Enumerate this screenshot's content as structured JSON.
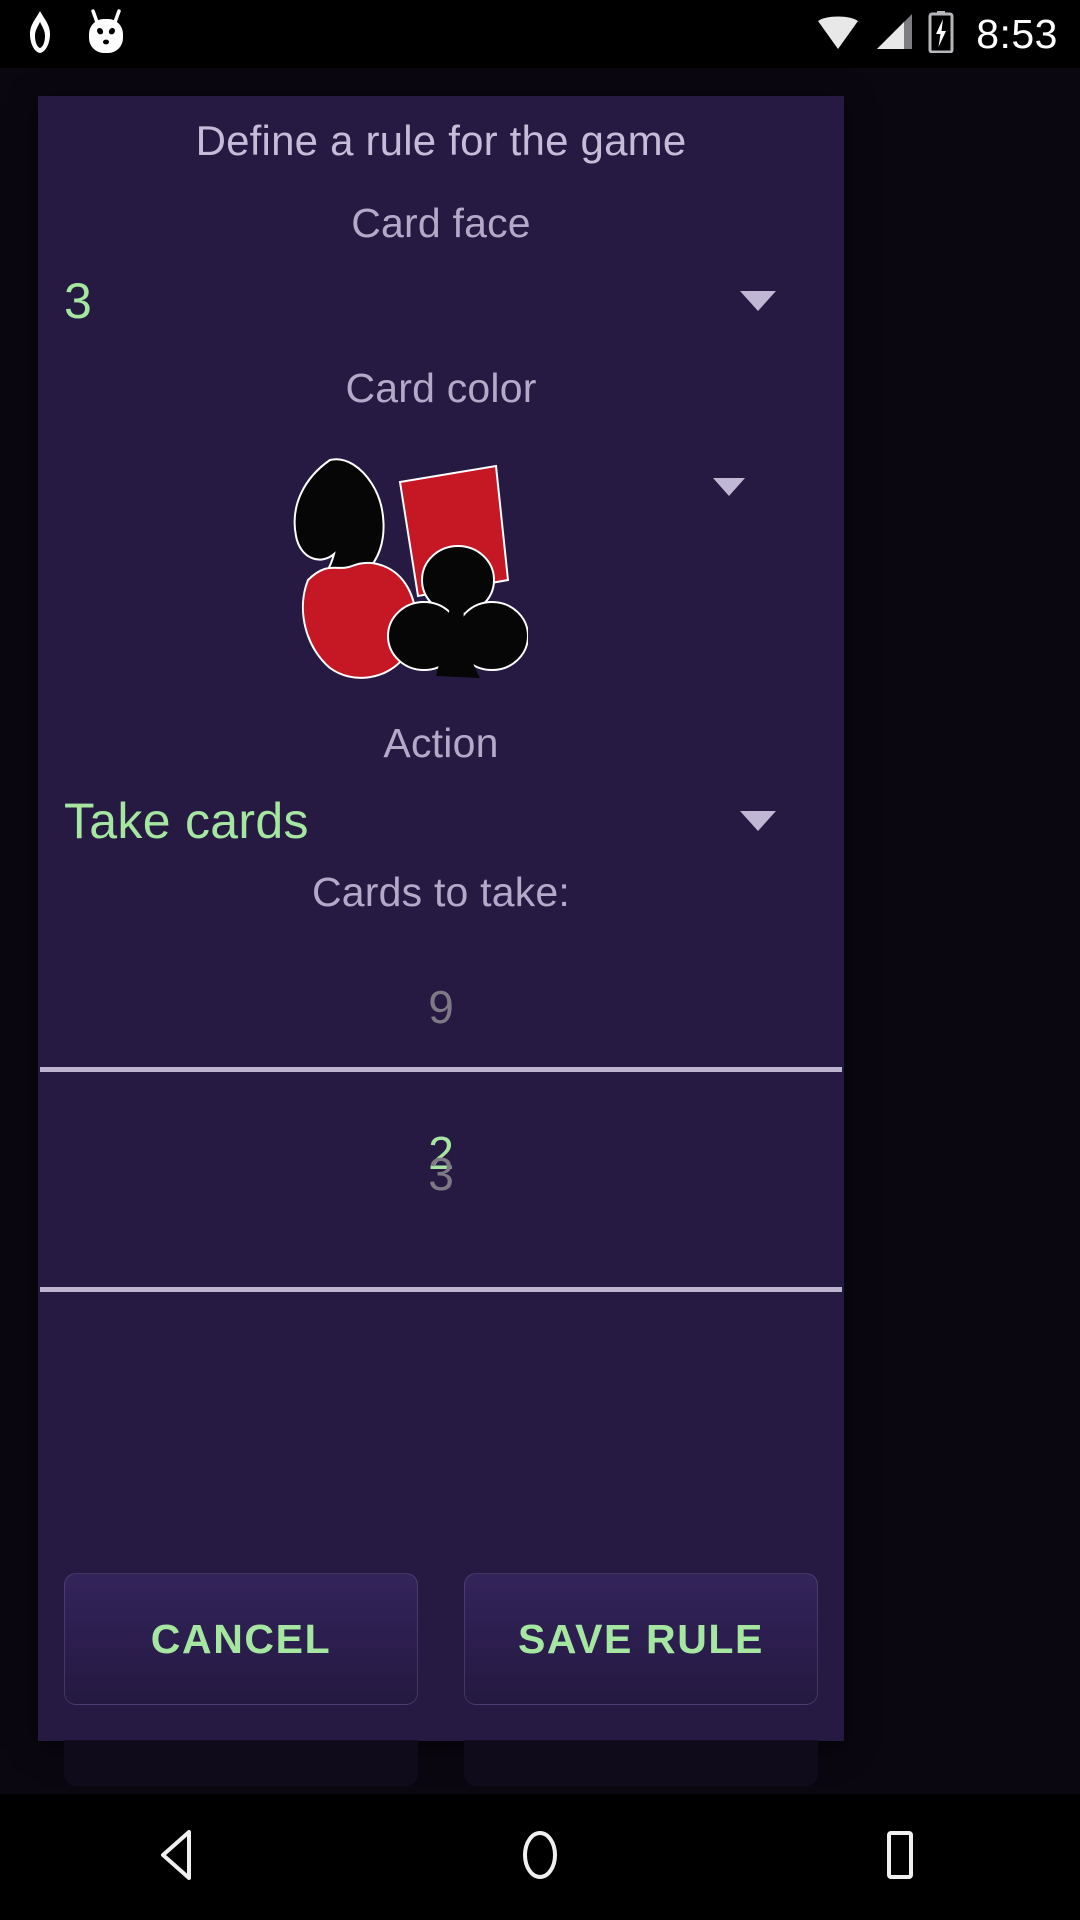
{
  "status_bar": {
    "icons": [
      "flame-icon",
      "cyanogenmod-icon",
      "wifi-icon",
      "cellular-signal-icon",
      "battery-charging-icon"
    ],
    "time": "8:53"
  },
  "dialog": {
    "title": "Define a rule for the game",
    "card_face": {
      "label": "Card face",
      "selected": "3",
      "caret": "chevron-down-icon"
    },
    "card_color": {
      "label": "Card color",
      "selected_image": "all-suits-icon",
      "caret": "chevron-down-icon"
    },
    "action": {
      "label": "Action",
      "selected": "Take cards",
      "caret": "chevron-down-icon"
    },
    "cards_to_take": {
      "label": "Cards to take:",
      "previous": "9",
      "selected": "2",
      "next": "3"
    },
    "buttons": {
      "cancel": "CANCEL",
      "save": "SAVE RULE"
    }
  },
  "nav_bar": {
    "back": "back-icon",
    "home": "home-icon",
    "recents": "recents-icon"
  },
  "colors": {
    "dialog_bg": "#271a42",
    "accent_green": "#a5e6a0",
    "label_text": "#b3a9c9",
    "divider": "#bdb4cf",
    "dim_text": "#7d7a85",
    "suit_red": "#c61824",
    "suit_black": "#060606"
  }
}
